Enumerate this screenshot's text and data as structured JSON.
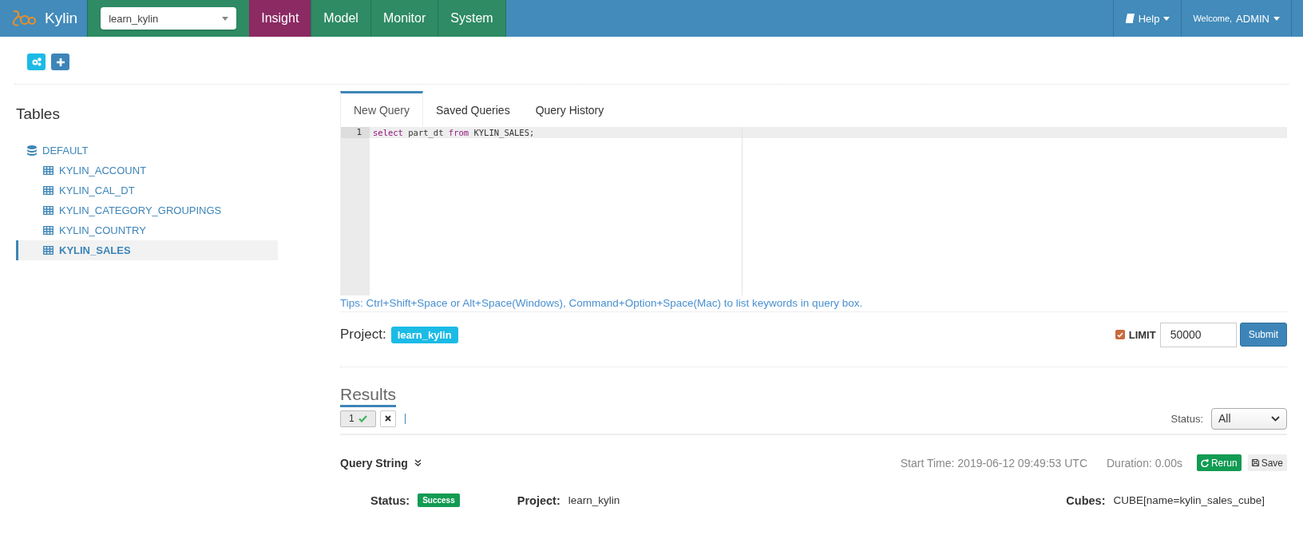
{
  "header": {
    "brand": "Kylin",
    "project_select": {
      "value": "learn_kylin"
    },
    "nav": [
      {
        "label": "Insight",
        "selected": true
      },
      {
        "label": "Model",
        "selected": false
      },
      {
        "label": "Monitor",
        "selected": false
      },
      {
        "label": "System",
        "selected": false
      }
    ],
    "help": "Help",
    "welcome": "Welcome,",
    "user": "ADMIN"
  },
  "sidebar": {
    "title": "Tables",
    "tree": [
      {
        "label": "DEFAULT",
        "kind": "database",
        "selected": false,
        "children": [
          {
            "label": "KYLIN_ACCOUNT",
            "kind": "table",
            "selected": false
          },
          {
            "label": "KYLIN_CAL_DT",
            "kind": "table",
            "selected": false
          },
          {
            "label": "KYLIN_CATEGORY_GROUPINGS",
            "kind": "table",
            "selected": false
          },
          {
            "label": "KYLIN_COUNTRY",
            "kind": "table",
            "selected": false
          },
          {
            "label": "KYLIN_SALES",
            "kind": "table",
            "selected": true
          }
        ]
      }
    ]
  },
  "query": {
    "tabs": [
      {
        "label": "New Query",
        "selected": true
      },
      {
        "label": "Saved Queries",
        "selected": false
      },
      {
        "label": "Query History",
        "selected": false
      }
    ],
    "editor": {
      "lines": [
        {
          "number": "1",
          "tokens": [
            {
              "text": "select",
              "kind": "keyword"
            },
            {
              "text": " part_dt ",
              "kind": "plain"
            },
            {
              "text": "from",
              "kind": "keyword"
            },
            {
              "text": " KYLIN_SALES;",
              "kind": "plain"
            }
          ]
        }
      ]
    },
    "tips": "Tips: Ctrl+Shift+Space or Alt+Space(Windows), Command+Option+Space(Mac) to list keywords in query box.",
    "project_label": "Project:",
    "project": "learn_kylin",
    "limit": {
      "checked": true,
      "label": "LIMIT",
      "value": "50000"
    },
    "submit": "Submit"
  },
  "results": {
    "title": "Results",
    "tabs": [
      {
        "label": "1",
        "succeeded": true,
        "selected": true
      }
    ],
    "status_label": "Status:",
    "status_filter": "All",
    "query_string": "Query String",
    "start_time": "Start Time: 2019-06-12 09:49:53 UTC",
    "duration": "Duration: 0.00s",
    "rerun": "Rerun",
    "save": "Save",
    "details": [
      {
        "label": "Status:",
        "value": "Success",
        "kind": "badge"
      },
      {
        "label": "Project:",
        "value": "learn_kylin",
        "kind": "text"
      },
      {
        "label": "Cubes:",
        "value": "CUBE[name=kylin_sales_cube]",
        "kind": "text"
      }
    ]
  }
}
